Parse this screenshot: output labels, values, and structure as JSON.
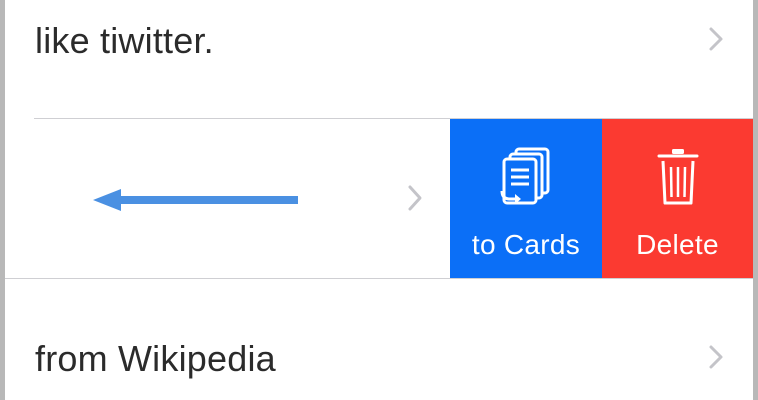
{
  "list": {
    "items": [
      {
        "label": "like tiwitter."
      },
      {
        "label": ""
      },
      {
        "label": "from Wikipedia"
      }
    ]
  },
  "swipe_actions": {
    "to_cards_label": "to Cards",
    "delete_label": "Delete",
    "to_cards_color": "#0b6ff7",
    "delete_color": "#fb3a31",
    "to_cards_icon": "cards-icon",
    "delete_icon": "trash-icon"
  },
  "gesture_hint": {
    "icon": "left-arrow-icon",
    "color": "#4a90e2"
  }
}
